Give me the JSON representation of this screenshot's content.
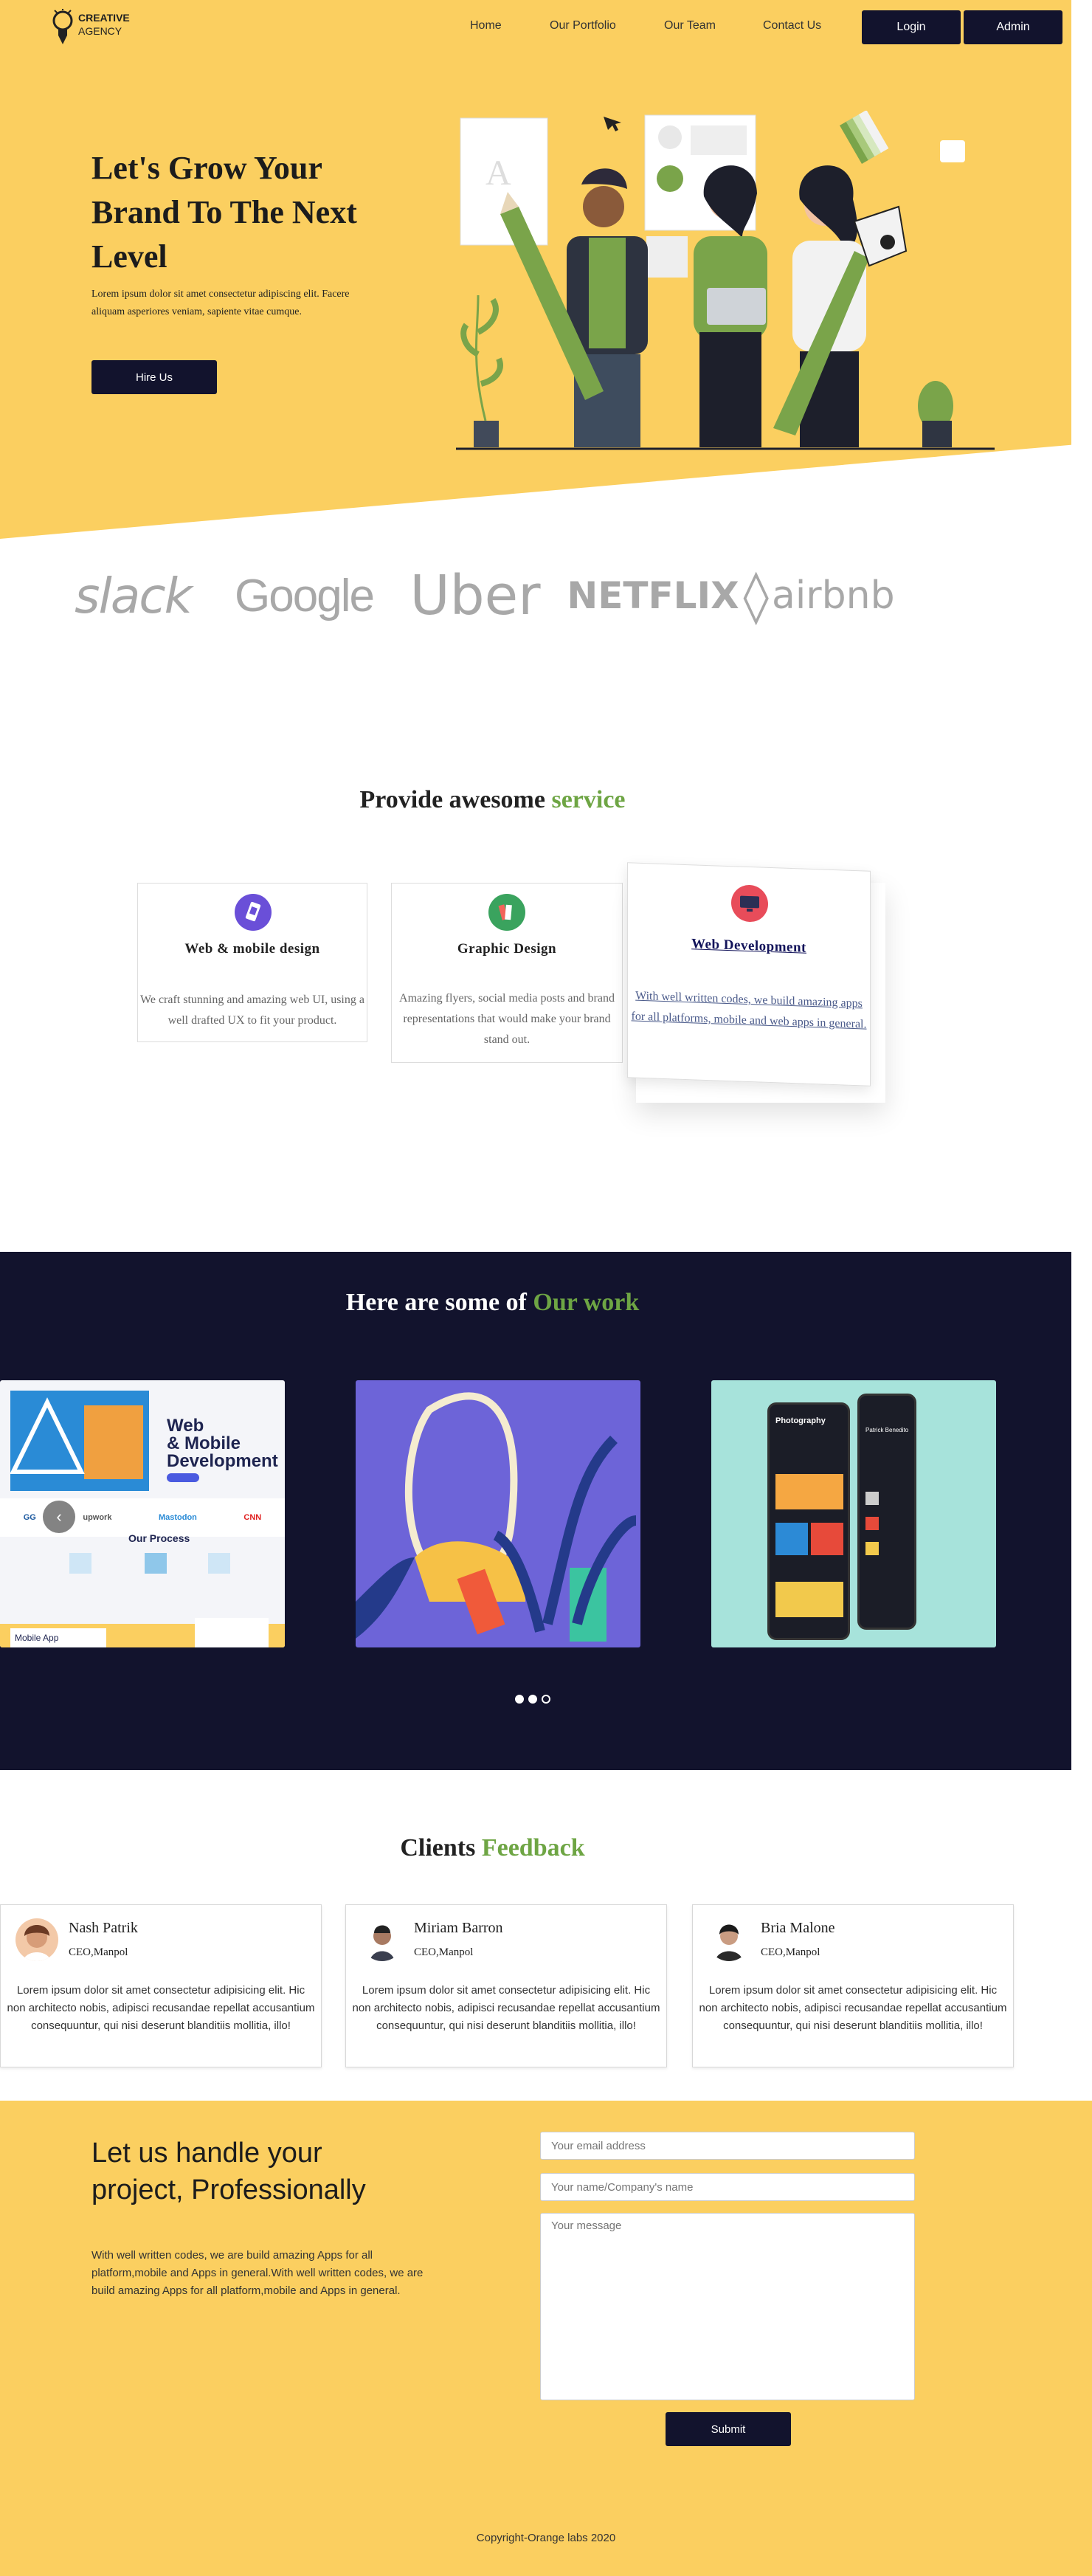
{
  "header": {
    "logo": {
      "line1": "CREATIVE",
      "line2": "AGENCY",
      "icon": "lightbulb-pencil-icon"
    },
    "nav": [
      "Home",
      "Our Portfolio",
      "Our Team",
      "Contact Us"
    ],
    "login_label": "Login",
    "admin_label": "Admin"
  },
  "hero": {
    "title": "Let's Grow Your Brand To The Next Level",
    "subtitle": "Lorem ipsum dolor sit amet consectetur adipiscing elit. Facere aliquam asperiores veniam, sapiente vitae cumque.",
    "cta_label": "Hire Us",
    "illustration": "team-illustration"
  },
  "brands": [
    "slack",
    "Google",
    "Uber",
    "NETFLIX",
    "airbnb"
  ],
  "services": {
    "title_prefix": "Provide awesome ",
    "title_highlight": "service",
    "items": [
      {
        "title": "Web & mobile design",
        "text": "We craft stunning and amazing web UI, using a well drafted UX to fit your product.",
        "icon": "mobile-design-icon"
      },
      {
        "title": "Graphic Design",
        "text": "Amazing flyers, social media posts and brand representations that would make your brand stand out.",
        "icon": "palette-icon"
      },
      {
        "title": "Web Development",
        "text": "With well written codes, we build amazing apps for all platforms, mobile and web apps in general.",
        "icon": "monitor-icon"
      }
    ]
  },
  "work": {
    "title_prefix": "Here are some of ",
    "title_highlight": "Our work",
    "slide1": {
      "headline1": "Web",
      "headline2": "& Mobile",
      "headline3": "Development",
      "process": "Our Process",
      "footer": "Mobile App"
    },
    "slide3": {
      "app_title": "Photography",
      "profile": "Patrick Benedito"
    },
    "prev_icon": "chevron-left-icon"
  },
  "feedback": {
    "title_prefix": "Clients ",
    "title_highlight": "Feedback",
    "items": [
      {
        "name": "Nash Patrik",
        "role": "CEO,Manpol",
        "text": "Lorem ipsum dolor sit amet consectetur adipisicing elit. Hic non architecto nobis, adipisci recusandae repellat accusantium consequuntur, qui nisi deserunt blanditiis mollitia, illo!"
      },
      {
        "name": "Miriam Barron",
        "role": "CEO,Manpol",
        "text": "Lorem ipsum dolor sit amet consectetur adipisicing elit. Hic non architecto nobis, adipisci recusandae repellat accusantium consequuntur, qui nisi deserunt blanditiis mollitia, illo!"
      },
      {
        "name": "Bria Malone",
        "role": "CEO,Manpol",
        "text": "Lorem ipsum dolor sit amet consectetur adipisicing elit. Hic non architecto nobis, adipisci recusandae repellat accusantium consequuntur, qui nisi deserunt blanditiis mollitia, illo!"
      }
    ]
  },
  "contact": {
    "title": "Let us handle your project, Professionally",
    "text": "With well written codes, we are build amazing Apps for all platform,mobile and Apps in general.With well written codes, we are build amazing Apps for all platform,mobile and Apps in general.",
    "email_placeholder": "Your email address",
    "name_placeholder": "Your name/Company's name",
    "message_placeholder": "Your message",
    "submit_label": "Submit"
  },
  "footer": {
    "copyright": "Copyright-Orange labs 2020"
  }
}
